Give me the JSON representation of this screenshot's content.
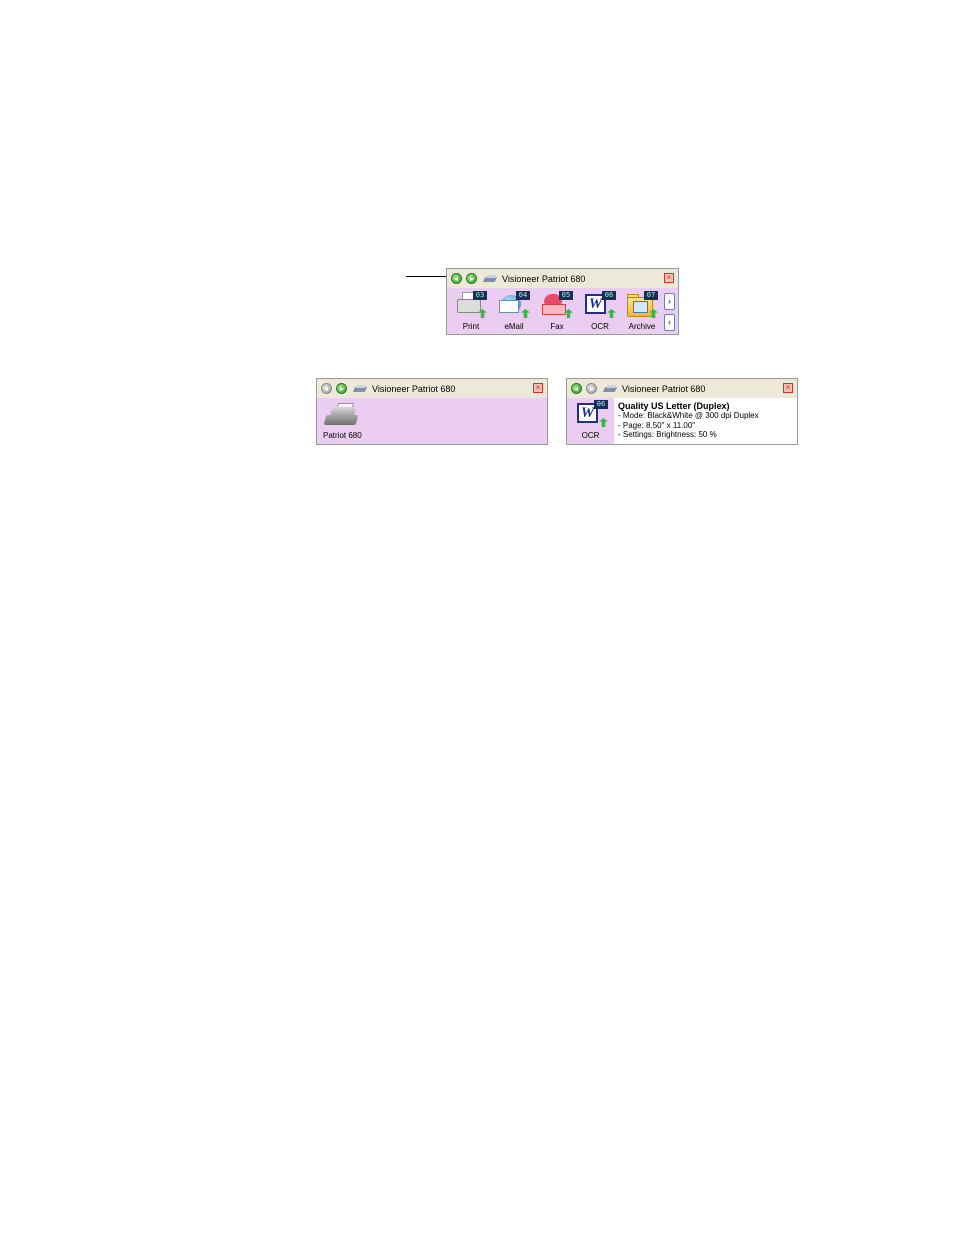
{
  "panel_main": {
    "title": "Visioneer Patriot 680",
    "buttons": [
      {
        "label": "Print",
        "badge": "03",
        "icon": "printer-icon"
      },
      {
        "label": "eMail",
        "badge": "04",
        "icon": "email-icon"
      },
      {
        "label": "Fax",
        "badge": "05",
        "icon": "fax-icon"
      },
      {
        "label": "OCR",
        "badge": "06",
        "icon": "word-ocr-icon"
      },
      {
        "label": "Archive",
        "badge": "07",
        "icon": "archive-folder-icon"
      }
    ],
    "scroll_right": "›",
    "scroll_left": "‹",
    "close": "×"
  },
  "panel_scanner": {
    "title": "Visioneer Patriot 680",
    "device_label": "Patriot 680",
    "close": "×"
  },
  "panel_detail": {
    "title": "Visioneer Patriot 680",
    "button_label": "OCR",
    "badge": "06",
    "config_title": "Quality US Letter (Duplex)",
    "lines": [
      "- Mode: Black&White @ 300 dpi Duplex",
      "- Page: 8.50\" x 11.00\"",
      "- Settings: Brightness: 50 %"
    ],
    "close": "×"
  },
  "colors": {
    "panel_background": "#eccdf2",
    "title_bar": "#ece9d8",
    "nav_green": "#2f9a23",
    "close_red": "#c0392b"
  }
}
